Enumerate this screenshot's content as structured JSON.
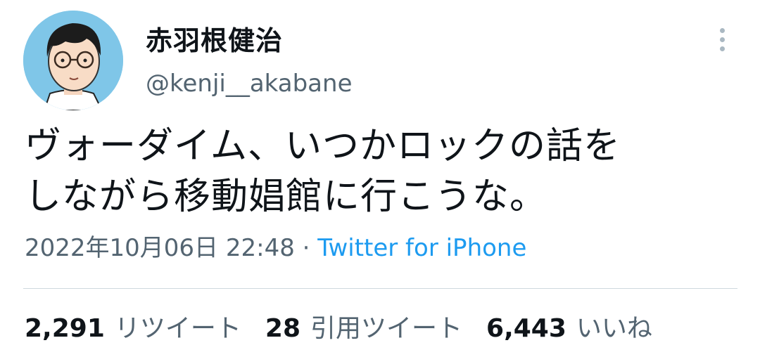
{
  "user": {
    "display_name": "赤羽根健治",
    "handle": "@kenji__akabane"
  },
  "tweet": {
    "line1": "ヴォーダイム、いつかロックの話を",
    "line2": "しながら移動娼館に行こうな。"
  },
  "meta": {
    "timestamp": "2022年10月06日 22:48",
    "separator": " · ",
    "source": "Twitter for iPhone"
  },
  "stats": [
    {
      "count": "2,291",
      "label": "リツイート"
    },
    {
      "count": "28",
      "label": "引用ツイート"
    },
    {
      "count": "6,443",
      "label": "いいね"
    }
  ],
  "colors": {
    "text": "#0f1419",
    "secondary": "#536471",
    "link": "#1d9bf0",
    "divider": "#cfd9de",
    "avatar_bg": "#7fc6e8"
  },
  "icons": {
    "more": "more-vertical-icon",
    "avatar": "avatar-illustration"
  }
}
